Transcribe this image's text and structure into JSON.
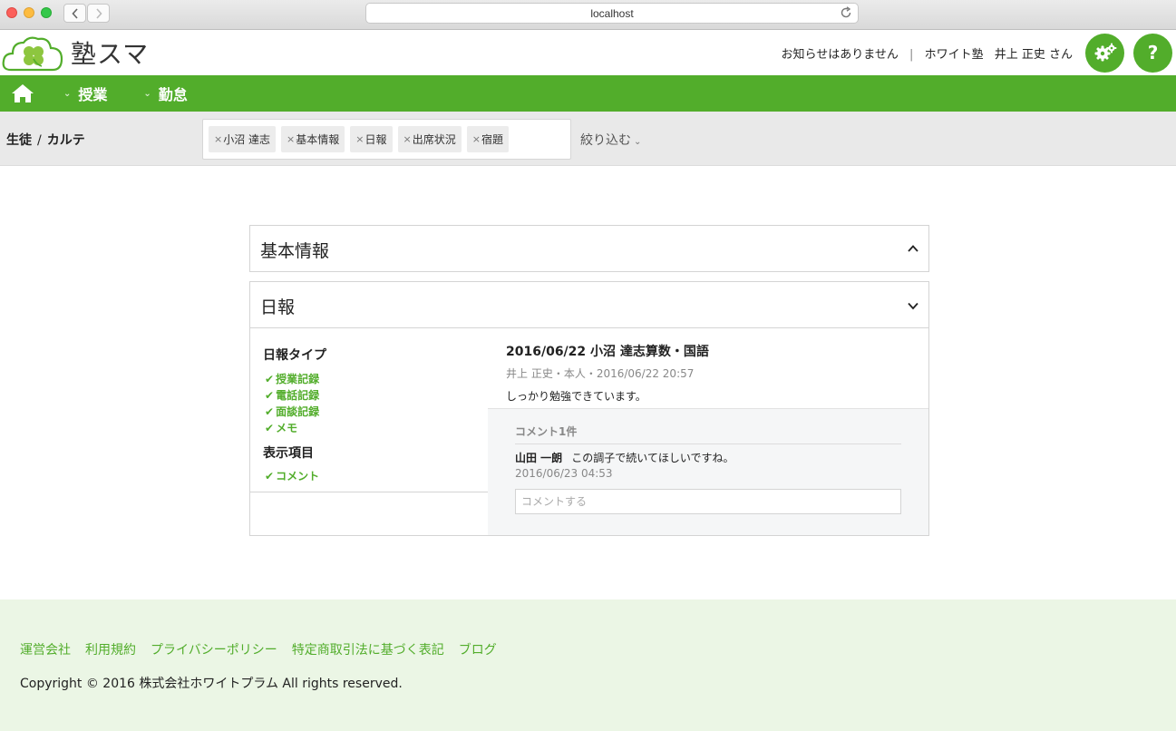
{
  "browser": {
    "url": "localhost"
  },
  "header": {
    "logo_text": "塾スマ",
    "notice": "お知らせはありません",
    "separator": "|",
    "school": "ホワイト塾",
    "user": "井上 正史 さん",
    "help_label": "?"
  },
  "nav": {
    "items": [
      {
        "label": "授業"
      },
      {
        "label": "勤怠"
      }
    ]
  },
  "filter": {
    "crumb_a": "生徒",
    "crumb_sep": "/",
    "crumb_b": "カルテ",
    "tags": [
      {
        "label": "小沼 達志"
      },
      {
        "label": "基本情報"
      },
      {
        "label": "日報"
      },
      {
        "label": "出席状況"
      },
      {
        "label": "宿題"
      }
    ],
    "tag_remove": "×",
    "refine_label": "絞り込む"
  },
  "panels": {
    "basic_title": "基本情報",
    "nippo_title": "日報"
  },
  "sidebar": {
    "type_heading": "日報タイプ",
    "types": [
      {
        "label": "授業記録"
      },
      {
        "label": "電話記録"
      },
      {
        "label": "面談記録"
      },
      {
        "label": "メモ"
      }
    ],
    "display_heading": "表示項目",
    "display_items": [
      {
        "label": "コメント"
      }
    ]
  },
  "entry": {
    "title": "2016/06/22 小沼 達志算数・国語",
    "meta": "井上 正史・本人・2016/06/22 20:57",
    "body": "しっかり勉強できています。"
  },
  "comments": {
    "count_label": "コメント1件",
    "author": "山田 一朗",
    "text": "この調子で続いてほしいですね。",
    "date": "2016/06/23 04:53",
    "input_placeholder": "コメントする"
  },
  "footer": {
    "links": [
      {
        "label": "運営会社"
      },
      {
        "label": "利用規約"
      },
      {
        "label": "プライバシーポリシー"
      },
      {
        "label": "特定商取引法に基づく表記"
      },
      {
        "label": "ブログ"
      }
    ],
    "copyright": "Copyright © 2016 株式会社ホワイトプラム All rights reserved."
  },
  "colors": {
    "brand_green": "#52ad2b",
    "footer_bg": "#ebf6e5"
  }
}
